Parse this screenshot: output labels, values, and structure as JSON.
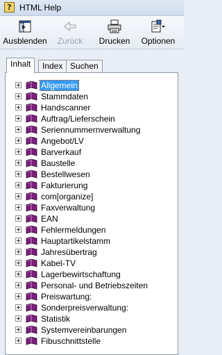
{
  "window": {
    "title": "HTML Help"
  },
  "toolbar": {
    "hide_label": "Ausblenden",
    "back_label": "Zurück",
    "print_label": "Drucken",
    "options_label": "Optionen"
  },
  "tabs": [
    {
      "label": "Inhalt"
    },
    {
      "label": "Index"
    },
    {
      "label": "Suchen"
    }
  ],
  "tree": {
    "items": [
      {
        "label": "Allgemein",
        "selected": true
      },
      {
        "label": "Stammdaten"
      },
      {
        "label": "Handscanner"
      },
      {
        "label": "Auftrag/Lieferschein"
      },
      {
        "label": "Seriennummernverwaltung"
      },
      {
        "label": "Angebot/LV"
      },
      {
        "label": "Barverkauf"
      },
      {
        "label": "Baustelle"
      },
      {
        "label": "Bestellwesen"
      },
      {
        "label": "Fakturierung"
      },
      {
        "label": "com[organize]"
      },
      {
        "label": "Faxverwaltung"
      },
      {
        "label": "EAN"
      },
      {
        "label": "Fehlermeldungen"
      },
      {
        "label": "Hauptartikelstamm"
      },
      {
        "label": "Jahresübertrag"
      },
      {
        "label": "Kabel-TV"
      },
      {
        "label": "Lagerbewirtschaftung"
      },
      {
        "label": "Personal- und Betriebszeiten"
      },
      {
        "label": "Preiswartung:"
      },
      {
        "label": "Sonderpreisverwaltung:"
      },
      {
        "label": "Statistik"
      },
      {
        "label": "Systemvereinbarungen"
      },
      {
        "label": "Fibuschnittstelle"
      }
    ]
  }
}
